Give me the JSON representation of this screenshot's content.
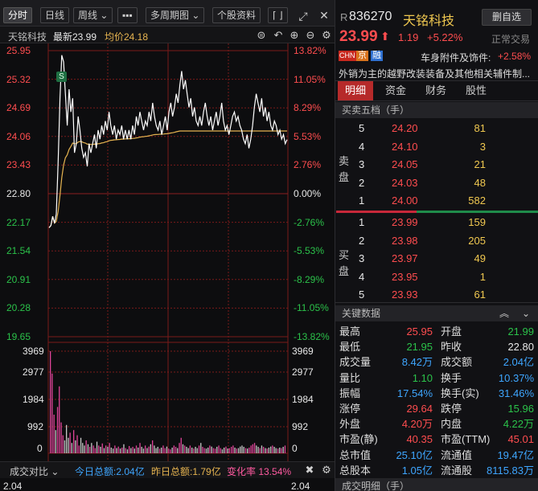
{
  "toolbar": {
    "tabs": [
      "分时",
      "日线",
      "周线 ⌄",
      "▪▪▪",
      "多周期图 ⌄",
      "个股资料",
      "⌈ ⌋"
    ]
  },
  "subbar": {
    "name": "天铭科技",
    "latest": "最新23.99",
    "avg": "均价24.18"
  },
  "price_axis": {
    "left": [
      "25.95",
      "25.32",
      "24.69",
      "24.06",
      "23.43",
      "22.80",
      "22.17",
      "21.54",
      "20.91",
      "20.28",
      "19.65"
    ],
    "right": [
      "13.82%",
      "11.05%",
      "8.29%",
      "5.53%",
      "2.76%",
      "0.00%",
      "-2.76%",
      "-5.53%",
      "-8.29%",
      "-11.05%",
      "-13.82%"
    ]
  },
  "vol_axis": {
    "left": [
      "3969",
      "2977",
      "1984",
      "992",
      "0"
    ],
    "right": [
      "3969",
      "2977",
      "1984",
      "992",
      "0"
    ]
  },
  "marker": "S",
  "bottombar": {
    "label": "成交对比 ⌄",
    "today": "今日总额:2.04亿",
    "yesterday": "昨日总额:1.79亿",
    "change": "变化率 13.54%",
    "lower_tick": "2.04"
  },
  "stock": {
    "prefix": "R",
    "code": "836270",
    "name": "天铭科技",
    "price": "23.99",
    "change": "1.19",
    "pct": "+5.22%",
    "watch_btn": "删自选",
    "status": "正常交易",
    "badges": [
      "CHN",
      "京",
      "融"
    ],
    "sector": "车身附件及饰件:",
    "sector_pct": "+2.58%",
    "desc": "外销为主的越野改装装备及其他相关辅件制..."
  },
  "tabs": [
    "明细",
    "资金",
    "财务",
    "股性"
  ],
  "orderbook": {
    "title": "买卖五档（手）",
    "sell_label": [
      "卖",
      "盘"
    ],
    "buy_label": [
      "买",
      "盘"
    ],
    "asks": [
      {
        "lvl": "5",
        "price": "24.20",
        "vol": "81"
      },
      {
        "lvl": "4",
        "price": "24.10",
        "vol": "3"
      },
      {
        "lvl": "3",
        "price": "24.05",
        "vol": "21"
      },
      {
        "lvl": "2",
        "price": "24.03",
        "vol": "48"
      },
      {
        "lvl": "1",
        "price": "24.00",
        "vol": "582"
      }
    ],
    "bids": [
      {
        "lvl": "1",
        "price": "23.99",
        "vol": "159"
      },
      {
        "lvl": "2",
        "price": "23.98",
        "vol": "205"
      },
      {
        "lvl": "3",
        "price": "23.97",
        "vol": "49"
      },
      {
        "lvl": "4",
        "price": "23.95",
        "vol": "1"
      },
      {
        "lvl": "5",
        "price": "23.93",
        "vol": "61"
      }
    ]
  },
  "key": {
    "title": "关键数据",
    "rows": [
      [
        "最高",
        "25.95",
        "开盘",
        "21.99"
      ],
      [
        "最低",
        "21.95",
        "昨收",
        "22.80"
      ],
      [
        "成交量",
        "8.42万",
        "成交额",
        "2.04亿"
      ],
      [
        "量比",
        "1.10",
        "换手",
        "10.37%"
      ],
      [
        "振幅",
        "17.54%",
        "换手(实)",
        "31.46%"
      ],
      [
        "涨停",
        "29.64",
        "跌停",
        "15.96"
      ],
      [
        "外盘",
        "4.20万",
        "内盘",
        "4.22万"
      ],
      [
        "市盈(静)",
        "40.35",
        "市盈(TTM)",
        "45.01"
      ],
      [
        "总市值",
        "25.10亿",
        "流通值",
        "19.47亿"
      ],
      [
        "总股本",
        "1.05亿",
        "流通股",
        "8115.83万"
      ]
    ]
  },
  "trade_detail": {
    "title": "成交明细（手）"
  },
  "colors": {
    "up": "#ff4d4f",
    "down": "#2bc24a",
    "price_line": "#ffffff",
    "avg_line": "#e6b450",
    "grid": "#7a1a1a"
  }
}
